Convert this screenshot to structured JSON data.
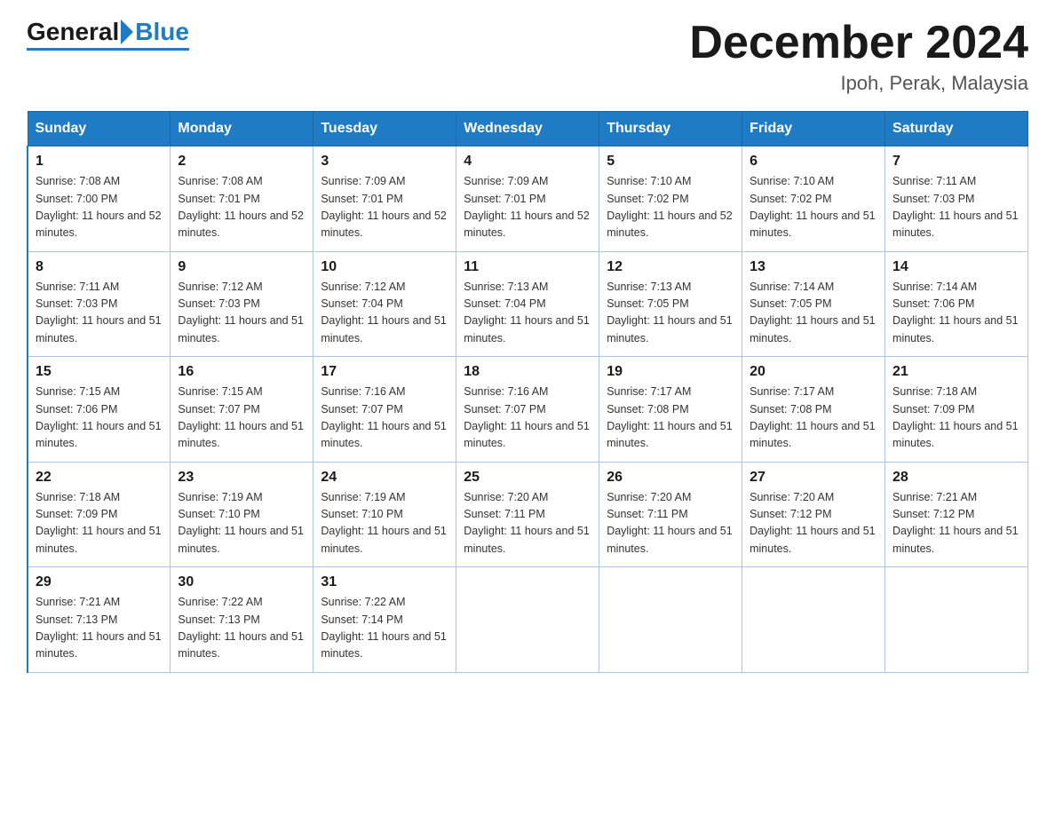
{
  "header": {
    "logo_general": "General",
    "logo_blue": "Blue",
    "month_title": "December 2024",
    "location": "Ipoh, Perak, Malaysia"
  },
  "days_of_week": [
    "Sunday",
    "Monday",
    "Tuesday",
    "Wednesday",
    "Thursday",
    "Friday",
    "Saturday"
  ],
  "weeks": [
    [
      {
        "day": "1",
        "sunrise": "7:08 AM",
        "sunset": "7:00 PM",
        "daylight": "11 hours and 52 minutes."
      },
      {
        "day": "2",
        "sunrise": "7:08 AM",
        "sunset": "7:01 PM",
        "daylight": "11 hours and 52 minutes."
      },
      {
        "day": "3",
        "sunrise": "7:09 AM",
        "sunset": "7:01 PM",
        "daylight": "11 hours and 52 minutes."
      },
      {
        "day": "4",
        "sunrise": "7:09 AM",
        "sunset": "7:01 PM",
        "daylight": "11 hours and 52 minutes."
      },
      {
        "day": "5",
        "sunrise": "7:10 AM",
        "sunset": "7:02 PM",
        "daylight": "11 hours and 52 minutes."
      },
      {
        "day": "6",
        "sunrise": "7:10 AM",
        "sunset": "7:02 PM",
        "daylight": "11 hours and 51 minutes."
      },
      {
        "day": "7",
        "sunrise": "7:11 AM",
        "sunset": "7:03 PM",
        "daylight": "11 hours and 51 minutes."
      }
    ],
    [
      {
        "day": "8",
        "sunrise": "7:11 AM",
        "sunset": "7:03 PM",
        "daylight": "11 hours and 51 minutes."
      },
      {
        "day": "9",
        "sunrise": "7:12 AM",
        "sunset": "7:03 PM",
        "daylight": "11 hours and 51 minutes."
      },
      {
        "day": "10",
        "sunrise": "7:12 AM",
        "sunset": "7:04 PM",
        "daylight": "11 hours and 51 minutes."
      },
      {
        "day": "11",
        "sunrise": "7:13 AM",
        "sunset": "7:04 PM",
        "daylight": "11 hours and 51 minutes."
      },
      {
        "day": "12",
        "sunrise": "7:13 AM",
        "sunset": "7:05 PM",
        "daylight": "11 hours and 51 minutes."
      },
      {
        "day": "13",
        "sunrise": "7:14 AM",
        "sunset": "7:05 PM",
        "daylight": "11 hours and 51 minutes."
      },
      {
        "day": "14",
        "sunrise": "7:14 AM",
        "sunset": "7:06 PM",
        "daylight": "11 hours and 51 minutes."
      }
    ],
    [
      {
        "day": "15",
        "sunrise": "7:15 AM",
        "sunset": "7:06 PM",
        "daylight": "11 hours and 51 minutes."
      },
      {
        "day": "16",
        "sunrise": "7:15 AM",
        "sunset": "7:07 PM",
        "daylight": "11 hours and 51 minutes."
      },
      {
        "day": "17",
        "sunrise": "7:16 AM",
        "sunset": "7:07 PM",
        "daylight": "11 hours and 51 minutes."
      },
      {
        "day": "18",
        "sunrise": "7:16 AM",
        "sunset": "7:07 PM",
        "daylight": "11 hours and 51 minutes."
      },
      {
        "day": "19",
        "sunrise": "7:17 AM",
        "sunset": "7:08 PM",
        "daylight": "11 hours and 51 minutes."
      },
      {
        "day": "20",
        "sunrise": "7:17 AM",
        "sunset": "7:08 PM",
        "daylight": "11 hours and 51 minutes."
      },
      {
        "day": "21",
        "sunrise": "7:18 AM",
        "sunset": "7:09 PM",
        "daylight": "11 hours and 51 minutes."
      }
    ],
    [
      {
        "day": "22",
        "sunrise": "7:18 AM",
        "sunset": "7:09 PM",
        "daylight": "11 hours and 51 minutes."
      },
      {
        "day": "23",
        "sunrise": "7:19 AM",
        "sunset": "7:10 PM",
        "daylight": "11 hours and 51 minutes."
      },
      {
        "day": "24",
        "sunrise": "7:19 AM",
        "sunset": "7:10 PM",
        "daylight": "11 hours and 51 minutes."
      },
      {
        "day": "25",
        "sunrise": "7:20 AM",
        "sunset": "7:11 PM",
        "daylight": "11 hours and 51 minutes."
      },
      {
        "day": "26",
        "sunrise": "7:20 AM",
        "sunset": "7:11 PM",
        "daylight": "11 hours and 51 minutes."
      },
      {
        "day": "27",
        "sunrise": "7:20 AM",
        "sunset": "7:12 PM",
        "daylight": "11 hours and 51 minutes."
      },
      {
        "day": "28",
        "sunrise": "7:21 AM",
        "sunset": "7:12 PM",
        "daylight": "11 hours and 51 minutes."
      }
    ],
    [
      {
        "day": "29",
        "sunrise": "7:21 AM",
        "sunset": "7:13 PM",
        "daylight": "11 hours and 51 minutes."
      },
      {
        "day": "30",
        "sunrise": "7:22 AM",
        "sunset": "7:13 PM",
        "daylight": "11 hours and 51 minutes."
      },
      {
        "day": "31",
        "sunrise": "7:22 AM",
        "sunset": "7:14 PM",
        "daylight": "11 hours and 51 minutes."
      },
      null,
      null,
      null,
      null
    ]
  ]
}
